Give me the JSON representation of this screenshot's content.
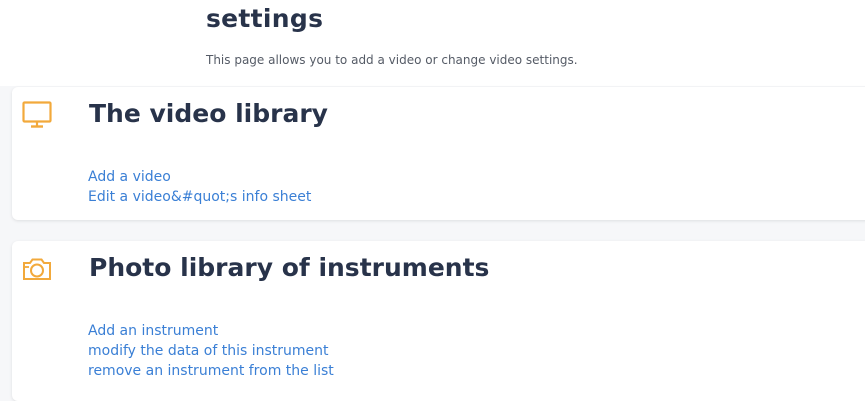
{
  "header": {
    "title": "settings",
    "subtitle": "This page allows you to add a video or change video settings."
  },
  "colors": {
    "accent_icon": "#f2a93b",
    "title_text": "#28334a",
    "link": "#3a7fd5"
  },
  "video_library": {
    "icon": "monitor-icon",
    "title": "The video library",
    "links": [
      "Add a video",
      "Edit a video&#quot;s info sheet"
    ]
  },
  "photo_library": {
    "icon": "camera-icon",
    "title": "Photo library of instruments",
    "links": [
      "Add an instrument",
      "modify the data of this instrument",
      "remove an instrument from the list"
    ]
  }
}
